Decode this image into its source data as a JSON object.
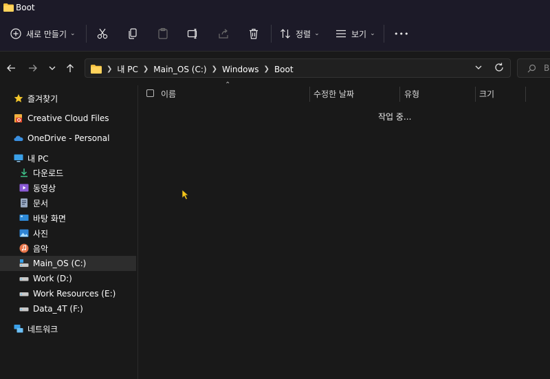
{
  "window": {
    "title": "Boot"
  },
  "toolbar": {
    "new_label": "새로 만들기",
    "sort_label": "정렬",
    "view_label": "보기",
    "more_label": "•••"
  },
  "address": {
    "crumbs": [
      "내 PC",
      "Main_OS (C:)",
      "Windows",
      "Boot"
    ]
  },
  "search": {
    "placeholder": "Bo"
  },
  "sidebar": {
    "items": [
      {
        "label": "즐겨찾기",
        "icon": "star-icon"
      },
      {
        "label": "Creative Cloud Files",
        "icon": "creative-cloud-icon"
      },
      {
        "label": "OneDrive - Personal",
        "icon": "onedrive-cloud-icon"
      },
      {
        "label": "내 PC",
        "icon": "pc-icon"
      },
      {
        "label": "다운로드",
        "icon": "download-icon"
      },
      {
        "label": "동영상",
        "icon": "video-icon"
      },
      {
        "label": "문서",
        "icon": "document-icon"
      },
      {
        "label": "바탕 화면",
        "icon": "desktop-icon"
      },
      {
        "label": "사진",
        "icon": "pictures-icon"
      },
      {
        "label": "음악",
        "icon": "music-icon"
      },
      {
        "label": "Main_OS (C:)",
        "icon": "os-drive-icon"
      },
      {
        "label": "Work (D:)",
        "icon": "drive-icon"
      },
      {
        "label": "Work Resources (E:)",
        "icon": "drive-icon"
      },
      {
        "label": "Data_4T (F:)",
        "icon": "drive-icon"
      },
      {
        "label": "네트워크",
        "icon": "network-icon"
      }
    ]
  },
  "columns": {
    "name": "이름",
    "modified": "수정한 날짜",
    "type": "유형",
    "size": "크기"
  },
  "status": {
    "loading": "작업 중..."
  },
  "colors": {
    "accent": "#4cc2ff",
    "background": "#191919",
    "chrome": "#1c1a28",
    "selected": "#2d2d2d"
  }
}
